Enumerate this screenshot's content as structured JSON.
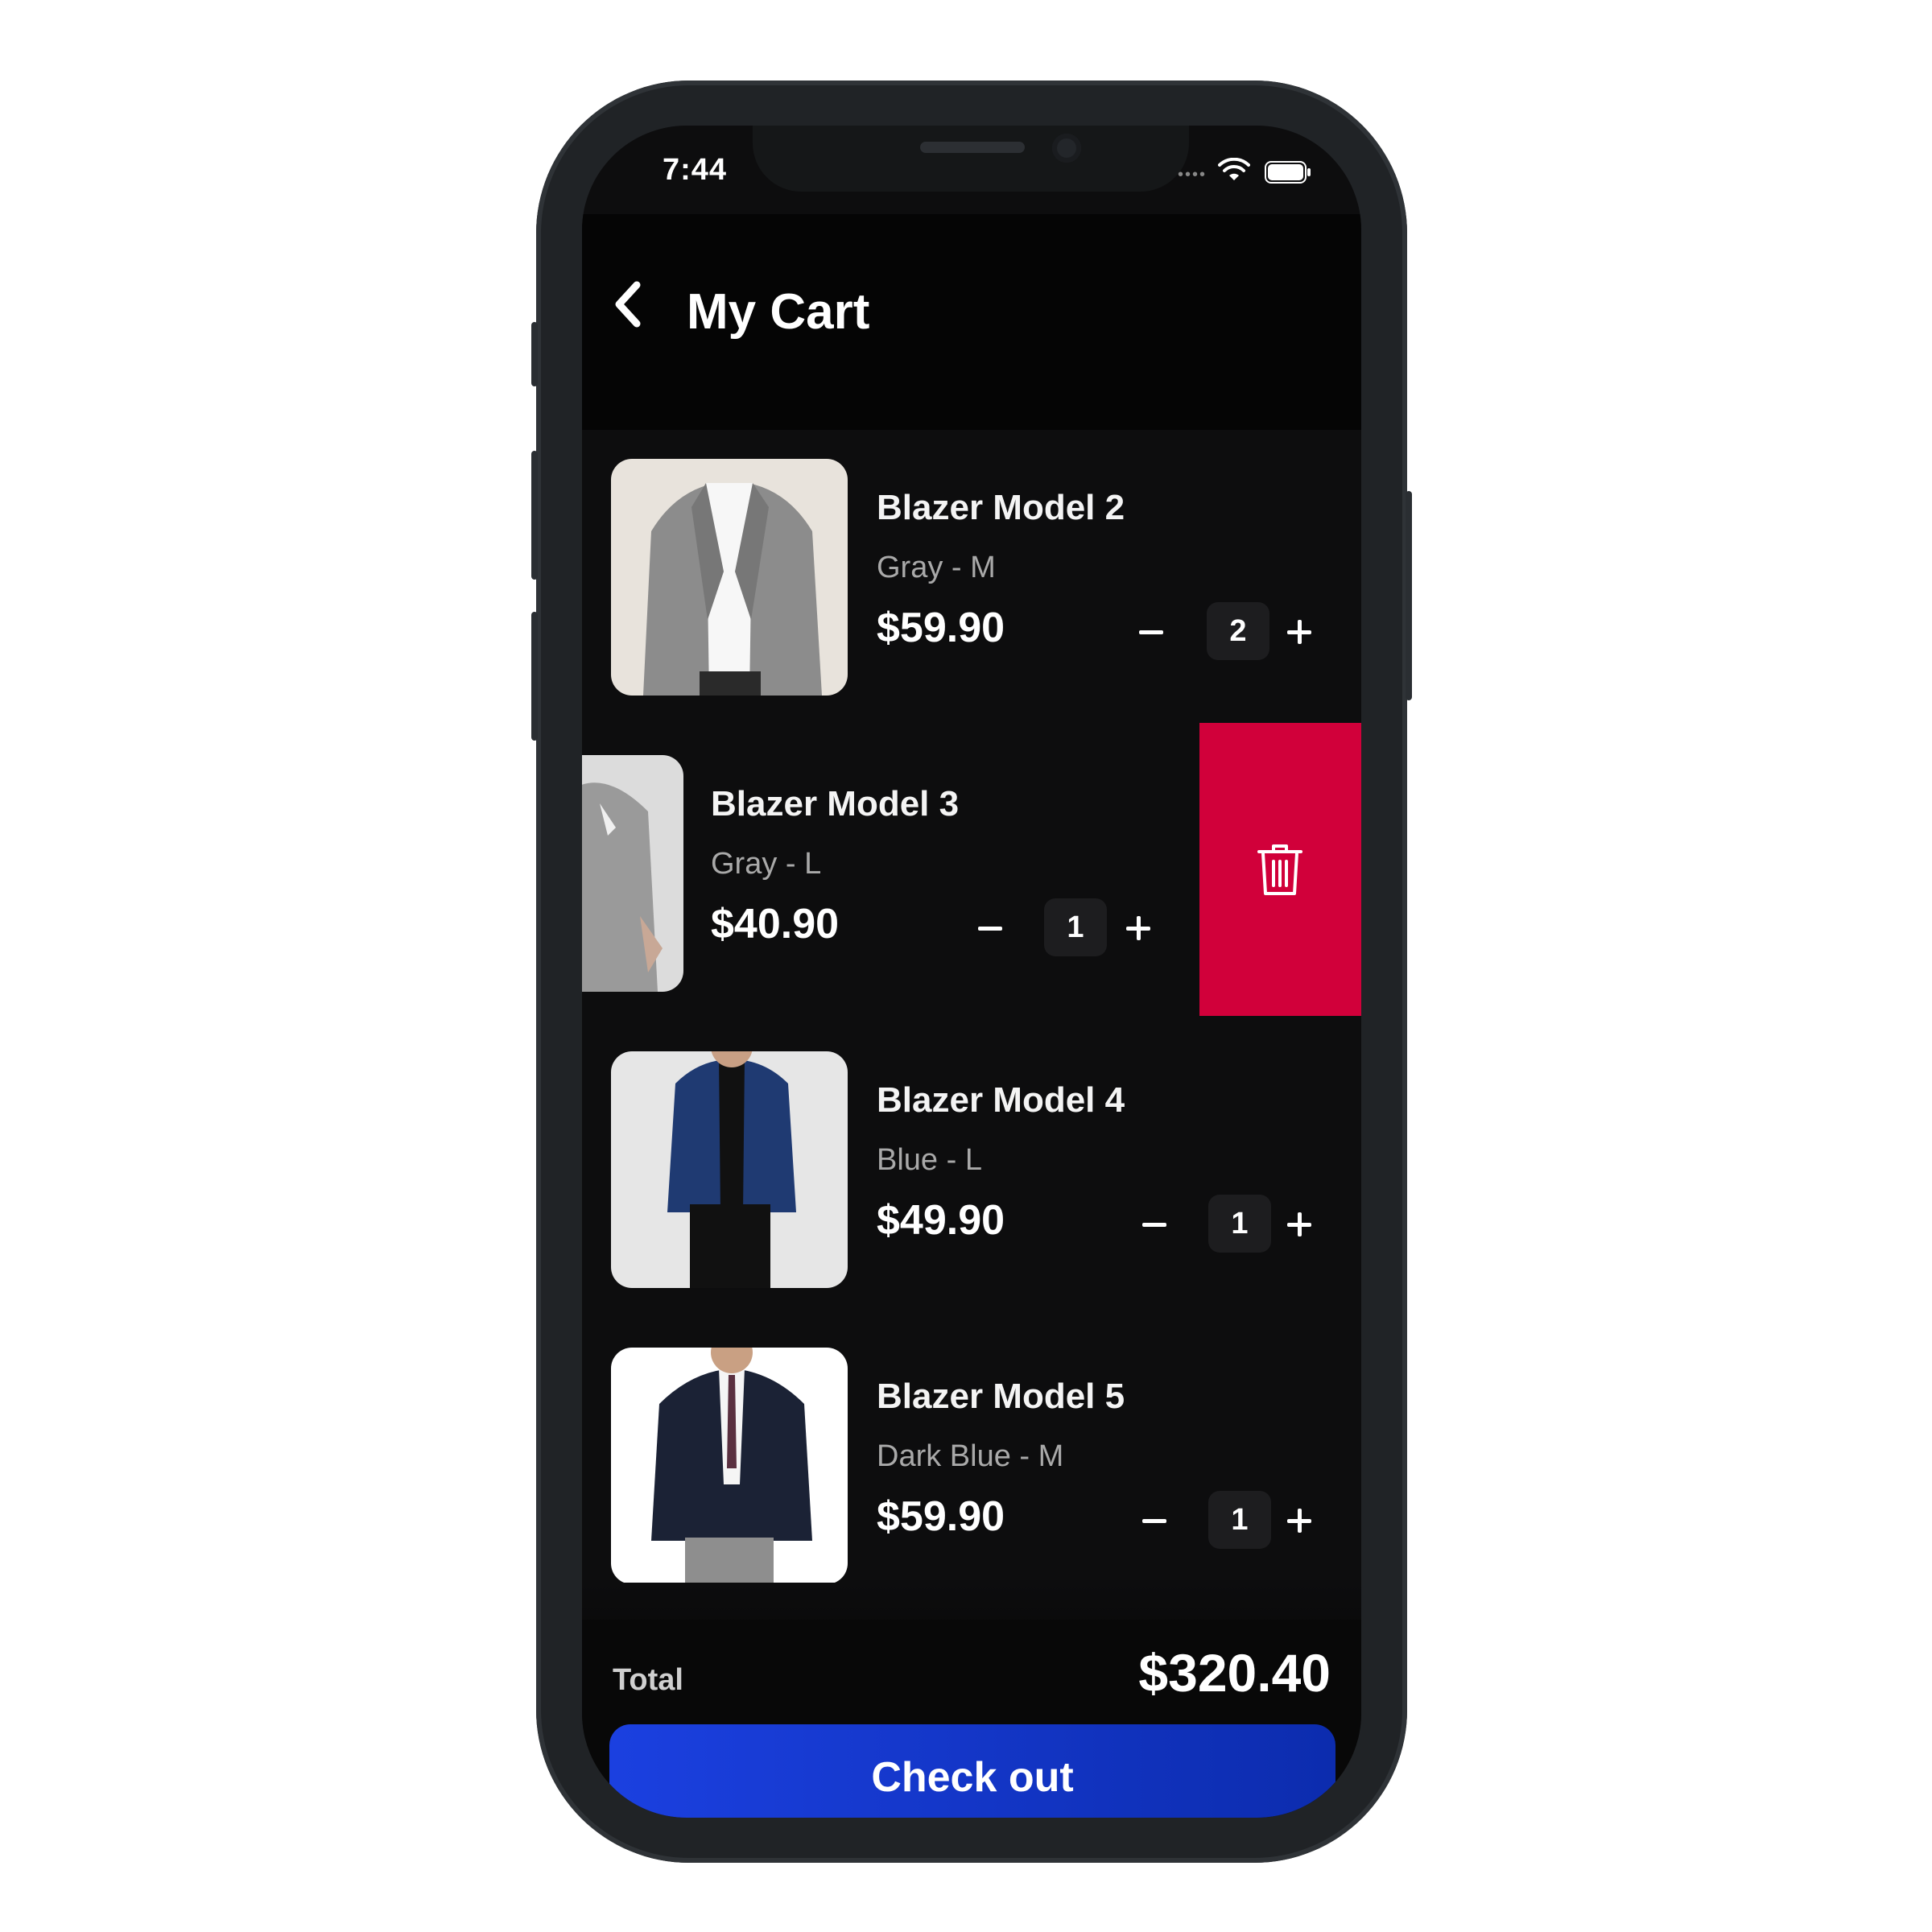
{
  "status": {
    "time": "7:44"
  },
  "header": {
    "title": "My Cart"
  },
  "items": [
    {
      "name": "Blazer Model 2",
      "variant": "Gray - M",
      "price": "$59.90",
      "qty": "2"
    },
    {
      "name": "Blazer Model 3",
      "variant": "Gray - L",
      "price": "$40.90",
      "qty": "1"
    },
    {
      "name": "Blazer Model 4",
      "variant": "Blue - L",
      "price": "$49.90",
      "qty": "1"
    },
    {
      "name": "Blazer Model 5",
      "variant": "Dark Blue - M",
      "price": "$59.90",
      "qty": "1"
    }
  ],
  "footer": {
    "total_label": "Total",
    "total_value": "$320.40",
    "checkout_label": "Check out"
  },
  "icons": {
    "back": "chevron-left-icon",
    "delete": "trash-icon",
    "wifi": "wifi-icon",
    "battery": "battery-icon"
  },
  "colors": {
    "delete": "#d1003a",
    "checkout": "#1b40e0",
    "background": "#0d0d0e"
  }
}
